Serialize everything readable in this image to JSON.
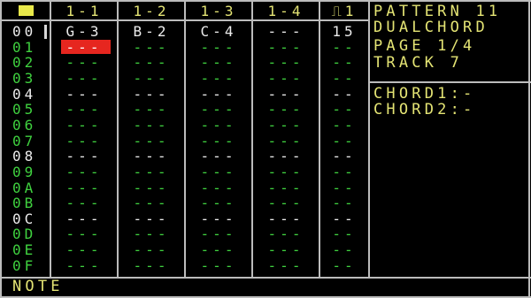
{
  "header": {
    "columns": [
      "1-1",
      "1-2",
      "1-3",
      "1-4",
      "⎍1"
    ]
  },
  "info": {
    "pattern_title": "PATTERN 11",
    "mode": "DUALCHORD",
    "page": "PAGE 1/4",
    "track": "TRACK 7",
    "chord1": "CHORD1:-",
    "chord2": "CHORD2:-"
  },
  "rows": [
    {
      "label": "00",
      "highlight": false,
      "cells": [
        "G-3",
        "B-2",
        "C-4",
        "---",
        "15"
      ]
    },
    {
      "label": "01",
      "highlight": true,
      "cells": [
        "---",
        "---",
        "---",
        "---",
        "--"
      ]
    },
    {
      "label": "02",
      "highlight": true,
      "cells": [
        "---",
        "---",
        "---",
        "---",
        "--"
      ]
    },
    {
      "label": "03",
      "highlight": true,
      "cells": [
        "---",
        "---",
        "---",
        "---",
        "--"
      ]
    },
    {
      "label": "04",
      "highlight": false,
      "cells": [
        "---",
        "---",
        "---",
        "---",
        "--"
      ]
    },
    {
      "label": "05",
      "highlight": true,
      "cells": [
        "---",
        "---",
        "---",
        "---",
        "--"
      ]
    },
    {
      "label": "06",
      "highlight": true,
      "cells": [
        "---",
        "---",
        "---",
        "---",
        "--"
      ]
    },
    {
      "label": "07",
      "highlight": true,
      "cells": [
        "---",
        "---",
        "---",
        "---",
        "--"
      ]
    },
    {
      "label": "08",
      "highlight": false,
      "cells": [
        "---",
        "---",
        "---",
        "---",
        "--"
      ]
    },
    {
      "label": "09",
      "highlight": true,
      "cells": [
        "---",
        "---",
        "---",
        "---",
        "--"
      ]
    },
    {
      "label": "0A",
      "highlight": true,
      "cells": [
        "---",
        "---",
        "---",
        "---",
        "--"
      ]
    },
    {
      "label": "0B",
      "highlight": true,
      "cells": [
        "---",
        "---",
        "---",
        "---",
        "--"
      ]
    },
    {
      "label": "0C",
      "highlight": false,
      "cells": [
        "---",
        "---",
        "---",
        "---",
        "--"
      ]
    },
    {
      "label": "0D",
      "highlight": true,
      "cells": [
        "---",
        "---",
        "---",
        "---",
        "--"
      ]
    },
    {
      "label": "0E",
      "highlight": true,
      "cells": [
        "---",
        "---",
        "---",
        "---",
        "--"
      ]
    },
    {
      "label": "0F",
      "highlight": true,
      "cells": [
        "---",
        "---",
        "---",
        "---",
        "--"
      ]
    }
  ],
  "status": {
    "text": "NOTE"
  },
  "colors": {
    "background": "#000000",
    "grid": "#bcbcbc",
    "accent_yellow": "#e4e474",
    "row_white": "#ececec",
    "row_green": "#3fd13f",
    "cursor_red": "#e6261f"
  }
}
